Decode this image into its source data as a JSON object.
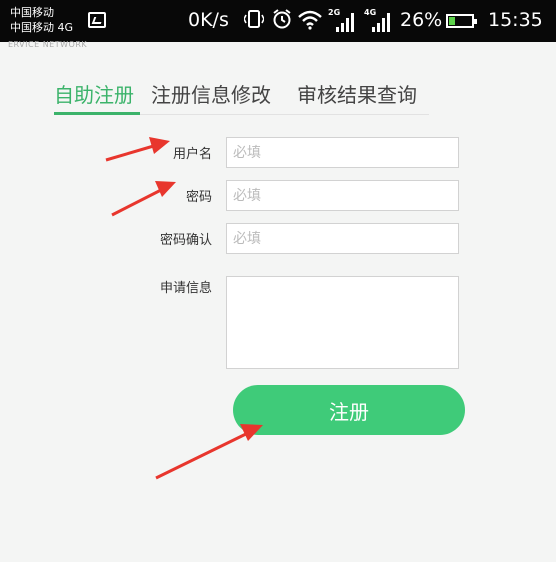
{
  "status_bar": {
    "carrier_line1": "中国移动",
    "carrier_line2": "中国移动 4G",
    "net_speed": "0K/s",
    "sig1_tag": "2G",
    "sig2_tag": "4G",
    "battery_percent": "26%",
    "battery_level": 0.26,
    "time": "15:35"
  },
  "header_text": "ERVICE NETWORK",
  "tabs": [
    {
      "label": "自助注册",
      "active": true
    },
    {
      "label": "注册信息修改",
      "active": false
    },
    {
      "label": "审核结果查询",
      "active": false
    }
  ],
  "form": {
    "username": {
      "label": "用户名",
      "placeholder": "必填"
    },
    "password": {
      "label": "密码",
      "placeholder": "必填"
    },
    "confirm": {
      "label": "密码确认",
      "placeholder": "必填"
    },
    "apply_info": {
      "label": "申请信息",
      "placeholder": ""
    },
    "submit_label": "注册"
  },
  "colors": {
    "accent": "#3bb36a",
    "button": "#3fcb79",
    "annotation_arrow": "#e8362d"
  }
}
